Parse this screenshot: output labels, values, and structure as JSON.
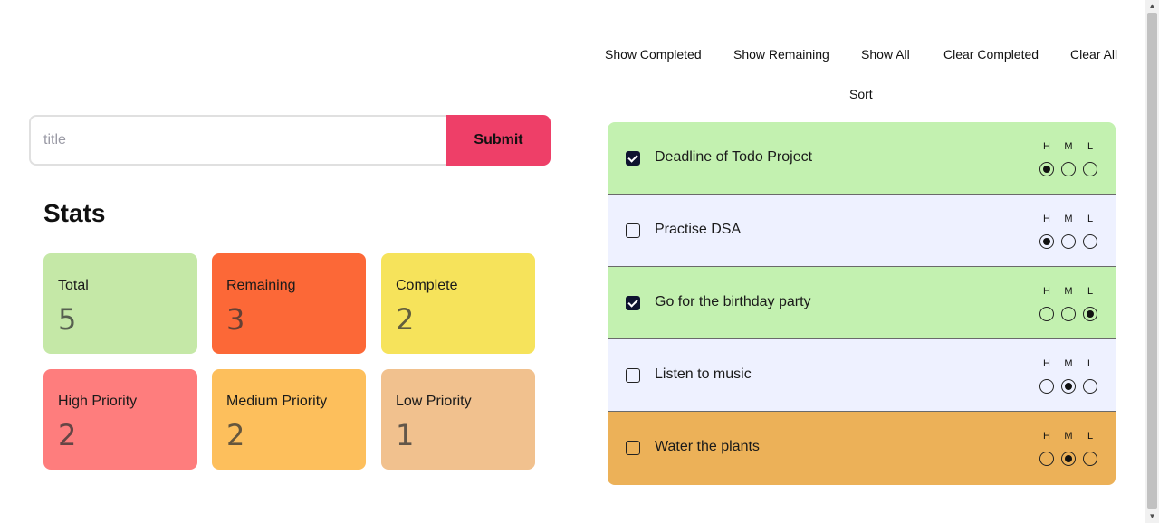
{
  "controls": {
    "show_completed": "Show Completed",
    "show_remaining": "Show Remaining",
    "show_all": "Show All",
    "clear_completed": "Clear Completed",
    "clear_all": "Clear All",
    "sort": "Sort"
  },
  "form": {
    "placeholder": "title",
    "value": "",
    "submit_label": "Submit",
    "submit_color": "#ee3f68"
  },
  "stats": {
    "title": "Stats",
    "cards": [
      {
        "label": "Total",
        "value": "5",
        "color": "#c5e8a7"
      },
      {
        "label": "Remaining",
        "value": "3",
        "color": "#fc6837"
      },
      {
        "label": "Complete",
        "value": "2",
        "color": "#f6e35b"
      },
      {
        "label": "High Priority",
        "value": "2",
        "color": "#fe7d7d"
      },
      {
        "label": "Medium Priority",
        "value": "2",
        "color": "#fdbf5c"
      },
      {
        "label": "Low Priority",
        "value": "1",
        "color": "#f1c18e"
      }
    ]
  },
  "priority_labels": {
    "high": "H",
    "medium": "M",
    "low": "L"
  },
  "todos": [
    {
      "title": "Deadline of Todo Project",
      "completed": true,
      "priority": "H",
      "bg": "#c3f1b0"
    },
    {
      "title": "Practise DSA",
      "completed": false,
      "priority": "H",
      "bg": "#eef1ff"
    },
    {
      "title": "Go for the birthday party",
      "completed": true,
      "priority": "L",
      "bg": "#c3f1b0"
    },
    {
      "title": "Listen to music",
      "completed": false,
      "priority": "M",
      "bg": "#eef1ff"
    },
    {
      "title": "Water the plants",
      "completed": false,
      "priority": "M",
      "bg": "#ecb158"
    }
  ]
}
